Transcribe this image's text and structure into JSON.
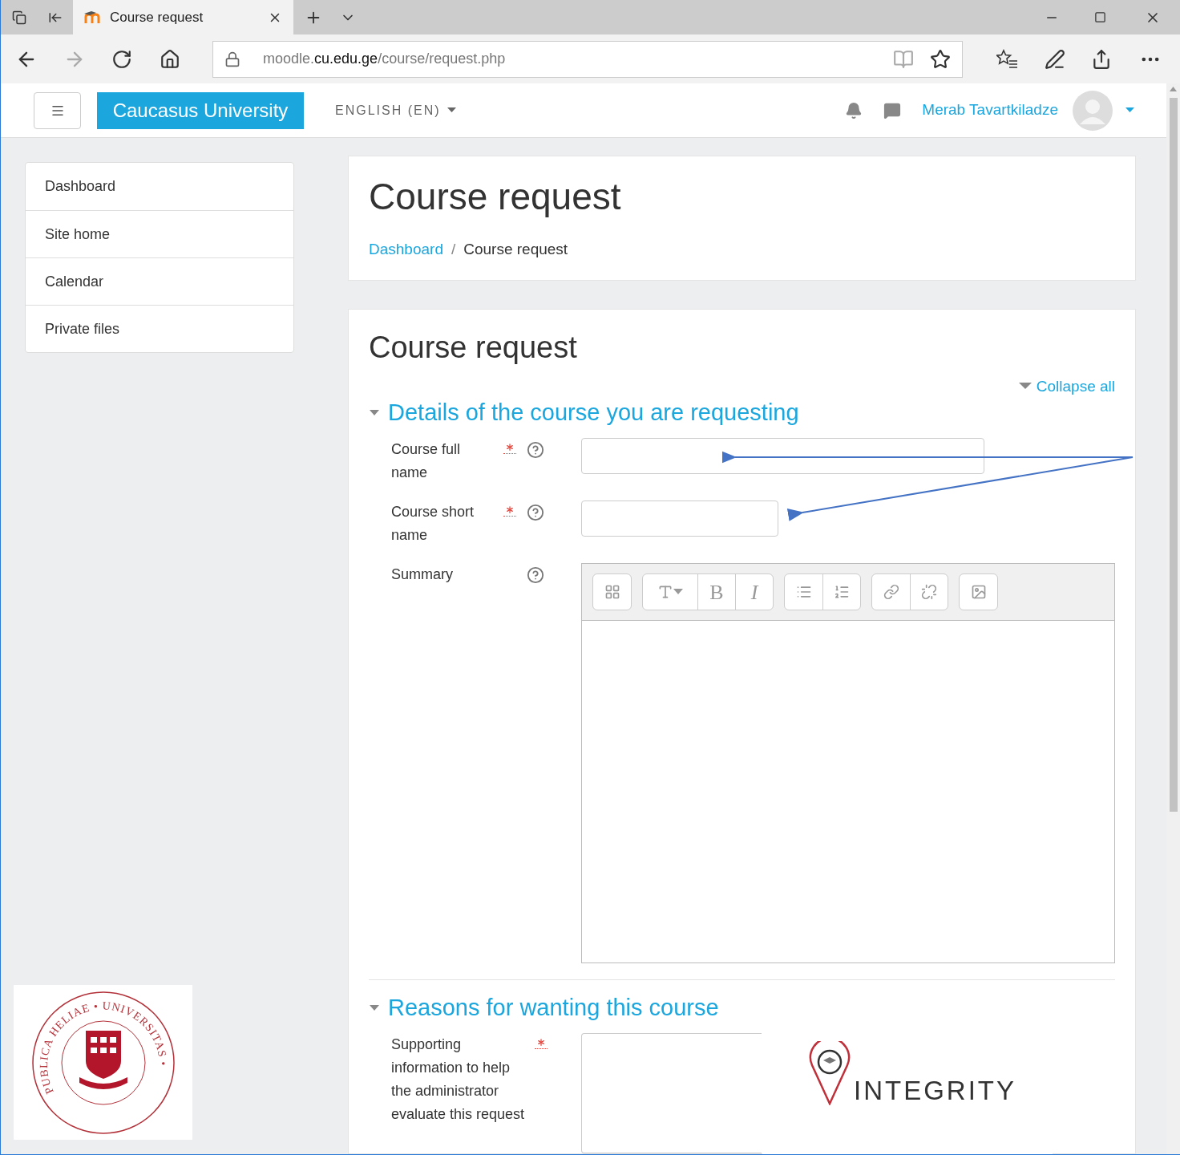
{
  "browser": {
    "tabs": [
      {
        "title": "Course request",
        "selected": true
      }
    ],
    "url": {
      "subdomain": "moodle.",
      "domain": "cu.edu.ge",
      "path": "/course/request.php"
    }
  },
  "navbar": {
    "brand": "Caucasus University",
    "language": "ENGLISH (EN)",
    "user_name": "Merab Tavartkiladze"
  },
  "sidebar": {
    "items": [
      {
        "label": "Dashboard"
      },
      {
        "label": "Site home"
      },
      {
        "label": "Calendar"
      },
      {
        "label": "Private files"
      }
    ]
  },
  "page_header": {
    "title": "Course request",
    "separator": "/",
    "breadcrumb": [
      {
        "label": "Dashboard",
        "link": true
      },
      {
        "label": "Course request",
        "link": false
      }
    ]
  },
  "form": {
    "title": "Course request",
    "collapse_all": "Collapse all",
    "sections": [
      {
        "title": "Details of the course you are requesting",
        "expanded": true,
        "fields": [
          {
            "label": "Course full name",
            "required": true,
            "help": true,
            "kind": "text-long"
          },
          {
            "label": "Course short name",
            "required": true,
            "help": true,
            "kind": "text-short"
          },
          {
            "label": "Summary",
            "required": false,
            "help": true,
            "kind": "editor",
            "toolbar": [
              [
                {
                  "kind": "more"
                }
              ],
              [
                {
                  "kind": "font"
                },
                {
                  "kind": "bold",
                  "label": "B"
                },
                {
                  "kind": "italic",
                  "label": "I"
                }
              ],
              [
                {
                  "kind": "bullets"
                },
                {
                  "kind": "numbers"
                }
              ],
              [
                {
                  "kind": "link"
                },
                {
                  "kind": "unlink"
                }
              ],
              [
                {
                  "kind": "image"
                }
              ]
            ]
          }
        ]
      },
      {
        "title": "Reasons for wanting this course",
        "expanded": true,
        "fields": [
          {
            "label": "Supporting information to help the administrator evaluate this request",
            "required": true,
            "help": false,
            "kind": "textarea"
          }
        ]
      }
    ]
  },
  "logos": {
    "seal_text": "PUBLICA HELIAE • UNIVERSITAS •",
    "integrity": "INTEGRITY"
  }
}
